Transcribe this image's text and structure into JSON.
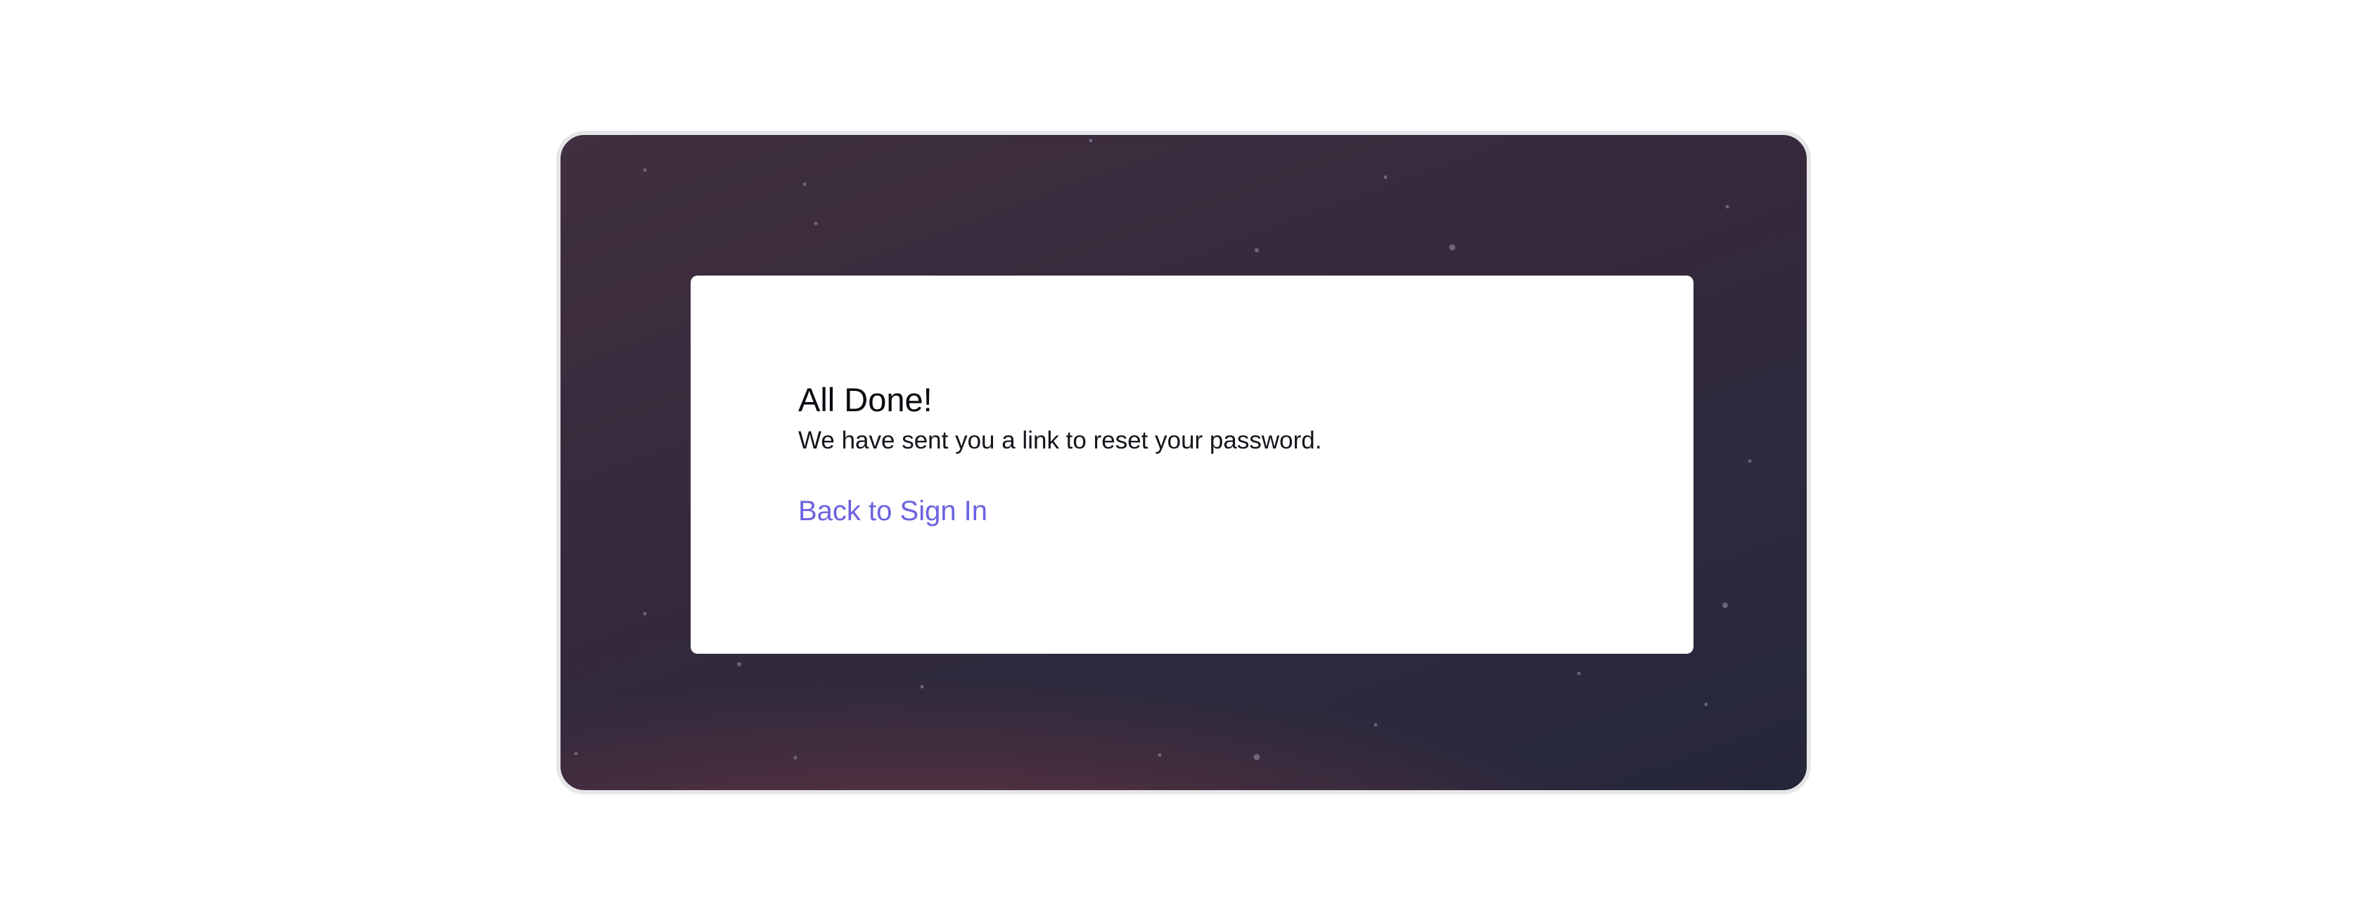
{
  "card": {
    "title": "All Done!",
    "message": "We have sent you a link to reset your password.",
    "back_link_label": "Back to Sign In"
  },
  "colors": {
    "link": "#6c63e0",
    "background_top": "#3f2f40",
    "background_bottom": "#6a3a46"
  }
}
